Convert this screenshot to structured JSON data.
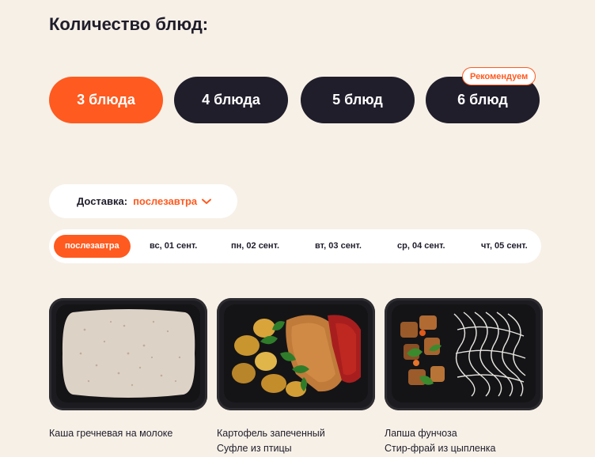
{
  "heading": "Количество блюд:",
  "count_options": [
    {
      "label": "3 блюда",
      "selected": true
    },
    {
      "label": "4 блюда",
      "selected": false
    },
    {
      "label": "5 блюд",
      "selected": false
    },
    {
      "label": "6 блюд",
      "selected": false
    }
  ],
  "recommended_badge": "Рекомендуем",
  "delivery": {
    "label": "Доставка:",
    "value": "послезавтра"
  },
  "dates": [
    {
      "label": "послезавтра",
      "selected": true
    },
    {
      "label": "вс, 01 сент.",
      "selected": false
    },
    {
      "label": "пн, 02 сент.",
      "selected": false
    },
    {
      "label": "вт, 03 сент.",
      "selected": false
    },
    {
      "label": "ср, 04 сент.",
      "selected": false
    },
    {
      "label": "чт, 05 сент.",
      "selected": false
    }
  ],
  "dishes": [
    {
      "line1": "Каша гречневая на молоке",
      "line2": ""
    },
    {
      "line1": "Картофель запеченный",
      "line2": "Суфле из птицы"
    },
    {
      "line1": "Лапша фунчоза",
      "line2": "Стир-фрай из цыпленка"
    }
  ],
  "colors": {
    "accent": "#ff5a1f",
    "dark": "#201e2b",
    "background": "#f7f0e7"
  }
}
